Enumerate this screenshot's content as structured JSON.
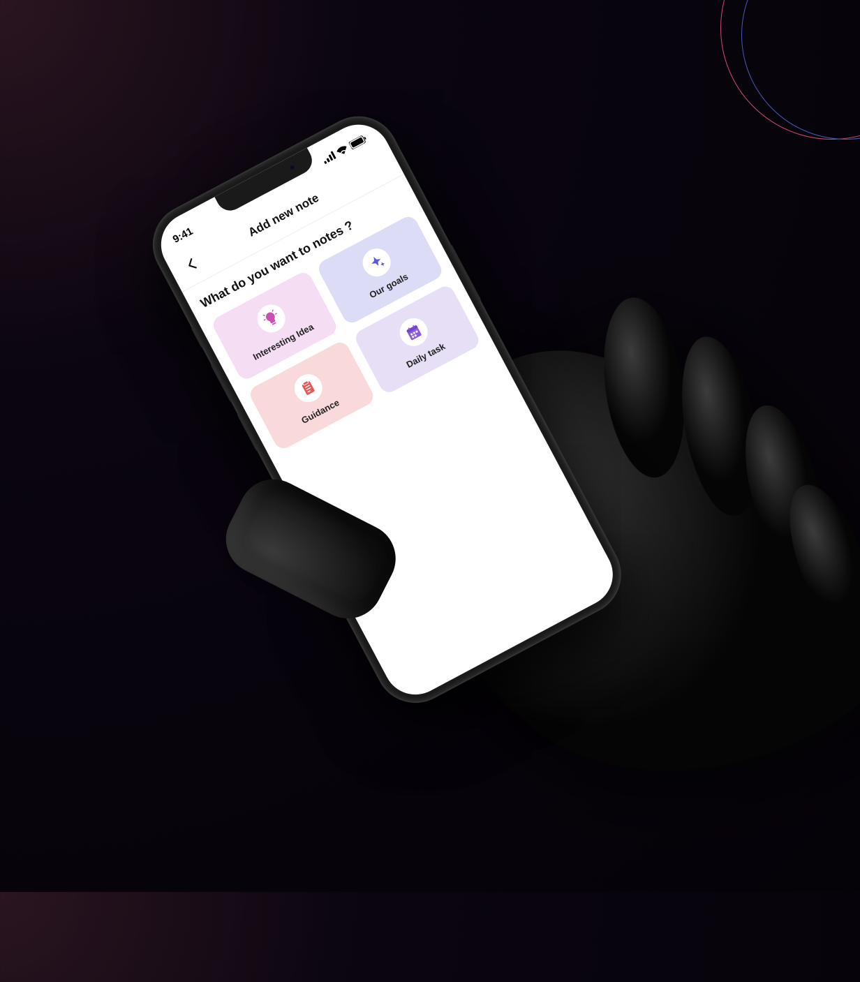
{
  "status_bar": {
    "time": "9:41"
  },
  "header": {
    "title": "Add new note"
  },
  "main": {
    "question": "What do you want to notes ?",
    "cards": [
      {
        "label": "Interesting Idea",
        "icon": "lightbulb-icon",
        "color": "#f5ddf3",
        "iconColor": "#c94fb2"
      },
      {
        "label": "Our goals",
        "icon": "sparkle-icon",
        "color": "#dcdcf7",
        "iconColor": "#5a5ae0"
      },
      {
        "label": "Guidance",
        "icon": "clipboard-icon",
        "color": "#f9d9d9",
        "iconColor": "#e05a5a"
      },
      {
        "label": "Daily task",
        "icon": "calendar-icon",
        "color": "#e7dff5",
        "iconColor": "#8a5ae0"
      }
    ]
  }
}
